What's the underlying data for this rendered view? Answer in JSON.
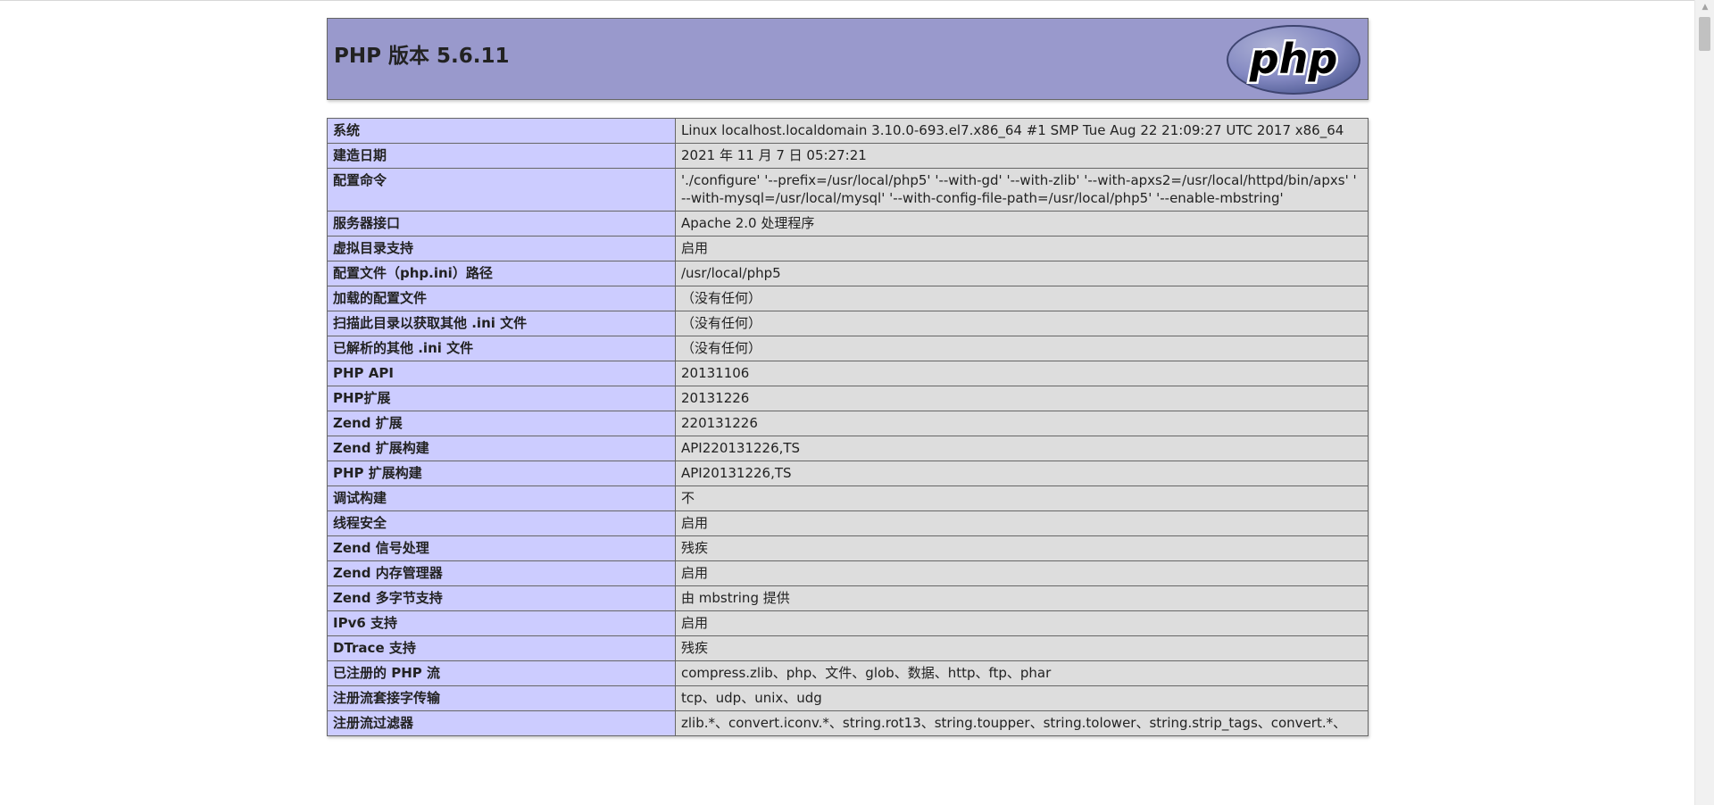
{
  "header": {
    "title": "PHP 版本 5.6.11",
    "logo_text": "php",
    "logo_icon": "php-logo-icon"
  },
  "rows": [
    {
      "key": "系统",
      "value": "Linux localhost.localdomain 3.10.0-693.el7.x86_64 #1 SMP Tue Aug 22 21:09:27 UTC 2017 x86_64"
    },
    {
      "key": "建造日期",
      "value": "2021 年 11 月 7 日 05:27:21"
    },
    {
      "key": "配置命令",
      "value": "'./configure' '--prefix=/usr/local/php5' '--with-gd' '--with-zlib' '--with-apxs2=/usr/local/httpd/bin/apxs' ' --with-mysql=/usr/local/mysql' '--with-config-file-path=/usr/local/php5' '--enable-mbstring'"
    },
    {
      "key": "服务器接口",
      "value": "Apache 2.0 处理程序"
    },
    {
      "key": "虚拟目录支持",
      "value": "启用"
    },
    {
      "key": "配置文件（php.ini）路径",
      "value": "/usr/local/php5"
    },
    {
      "key": "加载的配置文件",
      "value": "（没有任何）"
    },
    {
      "key": "扫描此目录以获取其他 .ini 文件",
      "value": "（没有任何）"
    },
    {
      "key": "已解析的其他 .ini 文件",
      "value": "（没有任何）"
    },
    {
      "key": "PHP API",
      "value": "20131106"
    },
    {
      "key": "PHP扩展",
      "value": "20131226"
    },
    {
      "key": "Zend 扩展",
      "value": "220131226"
    },
    {
      "key": "Zend 扩展构建",
      "value": "API220131226,TS"
    },
    {
      "key": "PHP 扩展构建",
      "value": "API20131226,TS"
    },
    {
      "key": "调试构建",
      "value": "不"
    },
    {
      "key": "线程安全",
      "value": "启用"
    },
    {
      "key": "Zend 信号处理",
      "value": "残疾"
    },
    {
      "key": "Zend 内存管理器",
      "value": "启用"
    },
    {
      "key": "Zend 多字节支持",
      "value": "由 mbstring 提供"
    },
    {
      "key": "IPv6 支持",
      "value": "启用"
    },
    {
      "key": "DTrace 支持",
      "value": "残疾"
    },
    {
      "key": "已注册的 PHP 流",
      "value": "compress.zlib、php、文件、glob、数据、http、ftp、phar"
    },
    {
      "key": "注册流套接字传输",
      "value": "tcp、udp、unix、udg"
    },
    {
      "key": "注册流过滤器",
      "value": "zlib.*、convert.iconv.*、string.rot13、string.toupper、string.tolower、string.strip_tags、convert.*、"
    }
  ]
}
